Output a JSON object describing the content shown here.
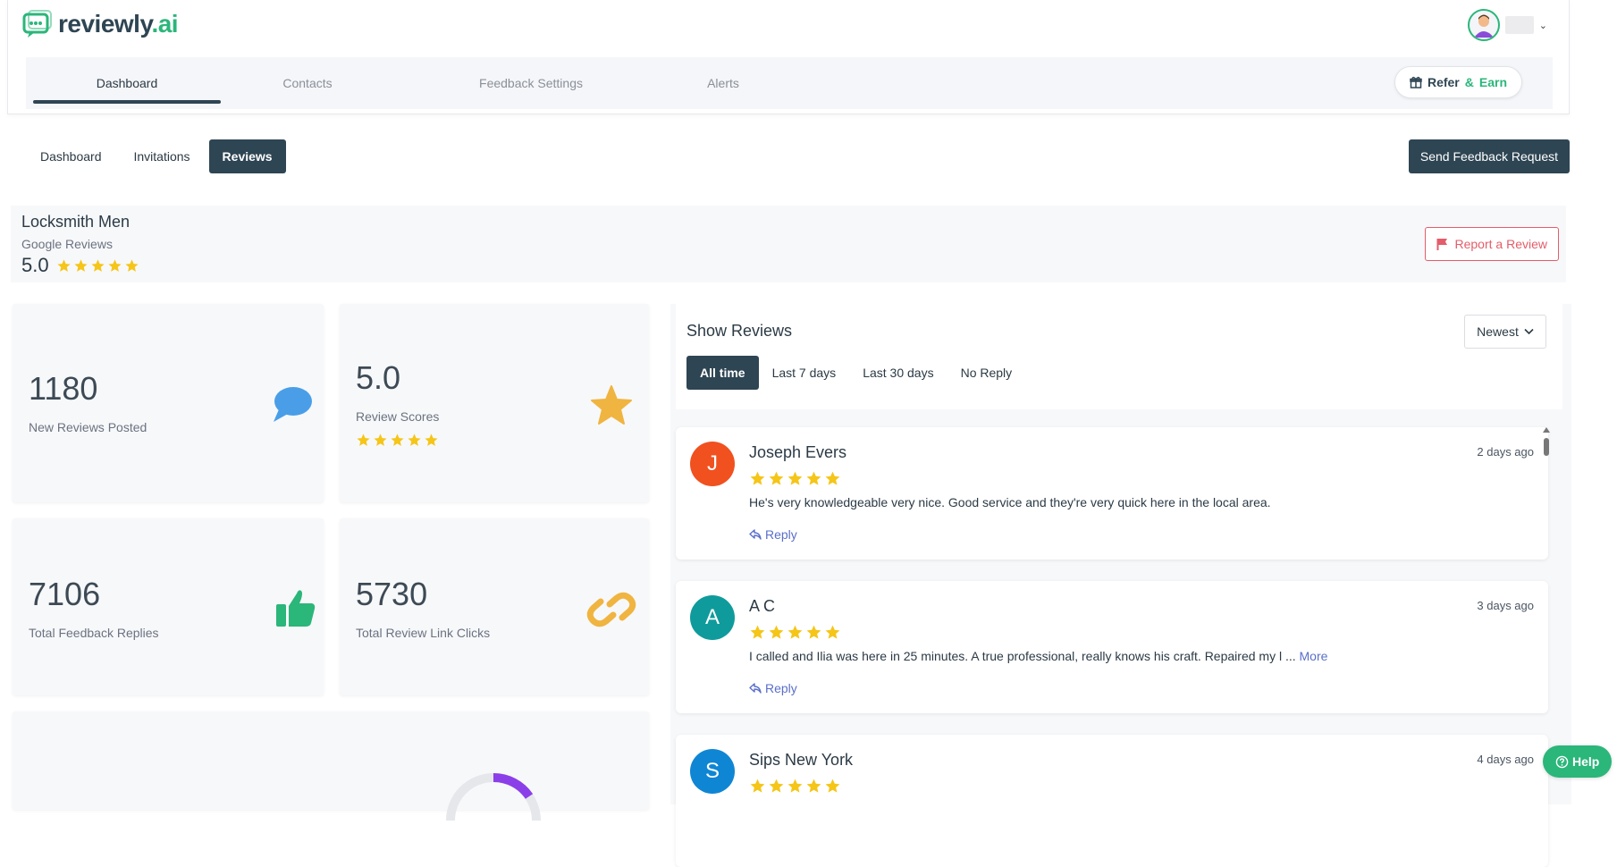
{
  "brand": {
    "name_main": "reviewly",
    "name_suffix": ".ai",
    "accent": "#2bb67a",
    "dark": "#2e4553"
  },
  "main_nav": {
    "tabs": [
      {
        "label": "Dashboard",
        "active": true
      },
      {
        "label": "Contacts",
        "active": false
      },
      {
        "label": "Feedback Settings",
        "active": false
      },
      {
        "label": "Alerts",
        "active": false
      }
    ],
    "refer_label": "Refer",
    "refer_amp": "&",
    "refer_earn": "Earn"
  },
  "sub_nav": {
    "tabs": [
      {
        "label": "Dashboard",
        "active": false
      },
      {
        "label": "Invitations",
        "active": false
      },
      {
        "label": "Reviews",
        "active": true
      }
    ],
    "send_label": "Send Feedback Request"
  },
  "business": {
    "name": "Locksmith Men",
    "source": "Google Reviews",
    "score": "5.0",
    "stars": 5,
    "report_label": "Report a Review"
  },
  "stats": {
    "new_reviews": {
      "value": "1180",
      "label": "New Reviews Posted"
    },
    "review_score": {
      "value": "5.0",
      "label": "Review Scores",
      "stars": 5
    },
    "feedback_replies": {
      "value": "7106",
      "label": "Total Feedback Replies"
    },
    "link_clicks": {
      "value": "5730",
      "label": "Total Review Link Clicks"
    }
  },
  "reviews_panel": {
    "title": "Show Reviews",
    "sort_value": "Newest",
    "filters": [
      {
        "label": "All time",
        "active": true
      },
      {
        "label": "Last 7 days",
        "active": false
      },
      {
        "label": "Last 30 days",
        "active": false
      },
      {
        "label": "No Reply",
        "active": false
      }
    ],
    "reply_label": "Reply",
    "items": [
      {
        "initial": "J",
        "color": "#f0511f",
        "name": "Joseph Evers",
        "date": "2 days ago",
        "stars": 5,
        "text": "He's very knowledgeable very nice. Good service and they're very quick here in the local area.",
        "more": ""
      },
      {
        "initial": "A",
        "color": "#0f9b9b",
        "name": "A C",
        "date": "3 days ago",
        "stars": 5,
        "text": "I called and Ilia was here in 25 minutes. A true professional, really knows his craft. Repaired my l ...",
        "more": "More"
      },
      {
        "initial": "S",
        "color": "#0f86d4",
        "name": "Sips New York",
        "date": "4 days ago",
        "stars": 5,
        "text": "",
        "more": ""
      }
    ]
  },
  "help_label": "Help"
}
